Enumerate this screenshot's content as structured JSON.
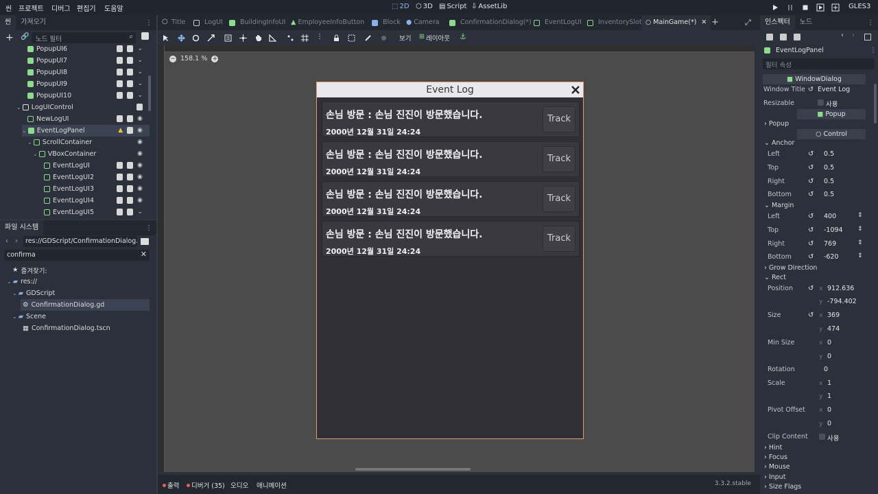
{
  "menu": {
    "items": [
      "씬",
      "프로젝트",
      "디버그",
      "편집기",
      "도움말"
    ],
    "workspaces": [
      "2D",
      "3D",
      "Script",
      "AssetLib"
    ],
    "renderer": "GLES3"
  },
  "scene_dock": {
    "tabs": [
      "씬",
      "가져오기"
    ],
    "filter_placeholder": "노드 필터",
    "nodes": [
      {
        "label": "PopupUI6"
      },
      {
        "label": "PopupUI7"
      },
      {
        "label": "PopupUI8"
      },
      {
        "label": "PopupUI9"
      },
      {
        "label": "PopupUI10"
      },
      {
        "label": "LogUIControl"
      },
      {
        "label": "NewLogUI"
      },
      {
        "label": "EventLogPanel"
      },
      {
        "label": "ScrollContainer"
      },
      {
        "label": "VBoxContainer"
      },
      {
        "label": "EventLogUI"
      },
      {
        "label": "EventLogUI2"
      },
      {
        "label": "EventLogUI3"
      },
      {
        "label": "EventLogUI4"
      },
      {
        "label": "EventLogUI5"
      }
    ]
  },
  "filesystem": {
    "title": "파일 시스템",
    "path": "res://GDScript/ConfirmationDialog.gd",
    "search_value": "confirma",
    "items": [
      {
        "label": "즐겨찾기:"
      },
      {
        "label": "res://"
      },
      {
        "label": "GDScript"
      },
      {
        "label": "ConfirmationDialog.gd"
      },
      {
        "label": "Scene"
      },
      {
        "label": "ConfirmationDialog.tscn"
      }
    ]
  },
  "scene_tabs": [
    "Title",
    "LogUI",
    "BuildingInfoUI",
    "EmployeeInfoButton",
    "Block",
    "Camera",
    "ConfirmationDialog(*)",
    "EventLogUI",
    "InventorySlot",
    "MainGame(*)"
  ],
  "toolbar": {
    "view_label": "보기",
    "layout_label": "레이아웃"
  },
  "viewport": {
    "zoom": "158.1 %"
  },
  "dialog": {
    "title": "Event Log",
    "events": [
      {
        "text": "손님 방문 : 손님 진진이 방문했습니다.",
        "date": "2000년 12월 31일 24:24",
        "button": "Track"
      },
      {
        "text": "손님 방문 : 손님 진진이 방문했습니다.",
        "date": "2000년 12월 31일 24:24",
        "button": "Track"
      },
      {
        "text": "손님 방문 : 손님 진진이 방문했습니다.",
        "date": "2000년 12월 31일 24:24",
        "button": "Track"
      },
      {
        "text": "손님 방문 : 손님 진진이 방문했습니다.",
        "date": "2000년 12월 31일 24:24",
        "button": "Track"
      }
    ]
  },
  "bottom_panel": {
    "tabs": [
      "출력",
      "디버거 (35)",
      "오디오",
      "애니메이션"
    ],
    "version": "3.3.2.stable"
  },
  "inspector": {
    "tabs": [
      "인스펙터",
      "노드"
    ],
    "node_name": "EventLogPanel",
    "filter_placeholder": "필터 속성",
    "class_window": "WindowDialog",
    "window_title_label": "Window Title",
    "window_title_value": "Event Log",
    "resizable_label": "Resizable",
    "resizable_value": "사용",
    "class_popup": "Popup",
    "popup_group": "Popup",
    "class_control": "Control",
    "anchor_group": "Anchor",
    "anchor": [
      {
        "label": "Left",
        "value": "0.5"
      },
      {
        "label": "Top",
        "value": "0.5"
      },
      {
        "label": "Right",
        "value": "0.5"
      },
      {
        "label": "Bottom",
        "value": "0.5"
      }
    ],
    "margin_group": "Margin",
    "margin": [
      {
        "label": "Left",
        "value": "400"
      },
      {
        "label": "Top",
        "value": "-1094"
      },
      {
        "label": "Right",
        "value": "769"
      },
      {
        "label": "Bottom",
        "value": "-620"
      }
    ],
    "grow_group": "Grow Direction",
    "rect_group": "Rect",
    "rect": {
      "position_label": "Position",
      "position_x": "912.636",
      "position_y": "-794.402",
      "size_label": "Size",
      "size_x": "369",
      "size_y": "474",
      "min_size_label": "Min Size",
      "min_x": "0",
      "min_y": "0",
      "rotation_label": "Rotation",
      "rotation": "0",
      "scale_label": "Scale",
      "scale_x": "1",
      "scale_y": "1",
      "pivot_label": "Pivot Offset",
      "pivot_x": "0",
      "pivot_y": "0",
      "clip_label": "Clip Content",
      "clip_value": "사용"
    },
    "groups": [
      "Hint",
      "Focus",
      "Mouse",
      "Input",
      "Size Flags"
    ]
  },
  "colors": {
    "accent": "#8eb8f0",
    "node_green": "#8eda8e",
    "dialog_border": "#e0a070"
  }
}
